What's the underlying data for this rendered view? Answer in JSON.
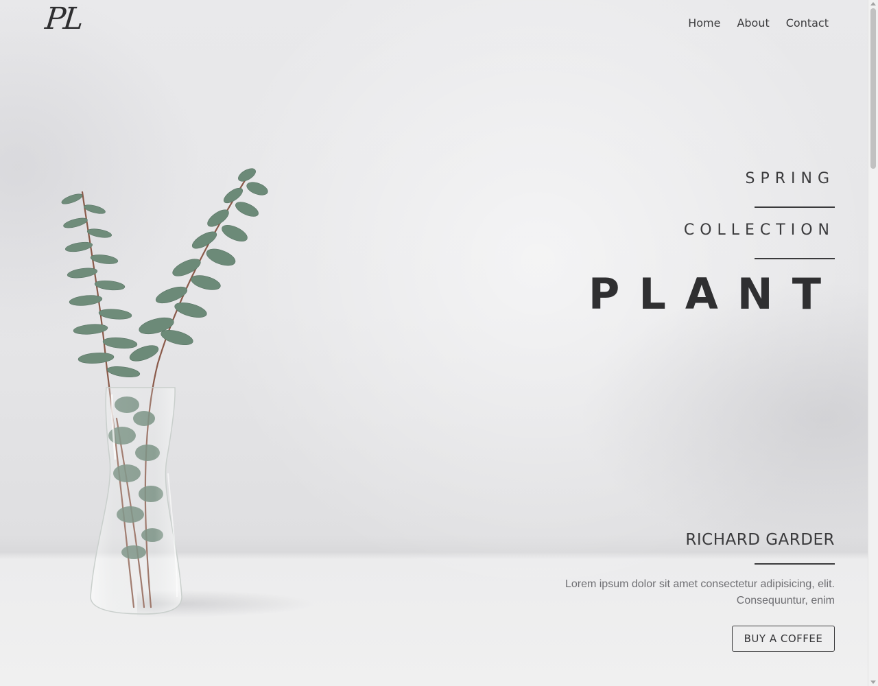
{
  "logo": {
    "text": "PL"
  },
  "nav": {
    "items": [
      {
        "label": "Home"
      },
      {
        "label": "About"
      },
      {
        "label": "Contact"
      }
    ]
  },
  "hero": {
    "line1": "SPRING",
    "line2": "COLLECTION",
    "title": "PLANT",
    "author": "RICHARD GARDER",
    "description": "Lorem ipsum dolor sit amet consectetur adipisicing, elit. Consequuntur, enim",
    "button_label": "BUY A COFFEE"
  },
  "images": {
    "hero_photo": "eucalyptus-in-glass-vase"
  },
  "colors": {
    "text_dark": "#333336",
    "text_muted": "#6e6e72",
    "background": "#e8e8ea",
    "foliage": "#6d8a78"
  }
}
